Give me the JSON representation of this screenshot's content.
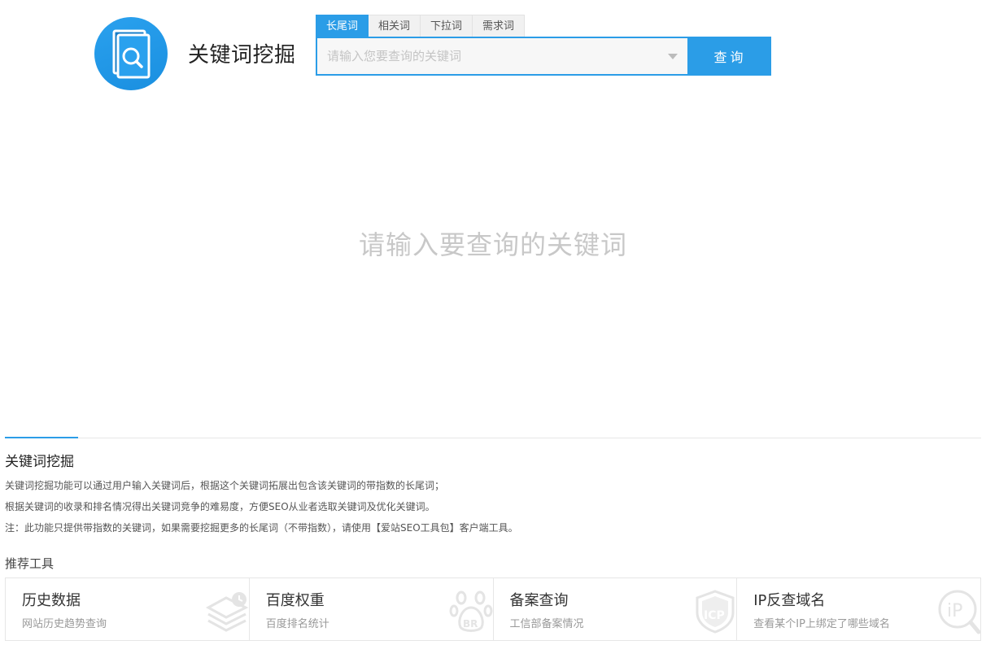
{
  "header": {
    "title": "关键词挖掘",
    "logo_icon": "search-document-icon"
  },
  "search": {
    "tabs": [
      {
        "label": "长尾词",
        "active": true
      },
      {
        "label": "相关词",
        "active": false
      },
      {
        "label": "下拉词",
        "active": false
      },
      {
        "label": "需求词",
        "active": false
      }
    ],
    "placeholder": "请输入您要查询的关键词",
    "value": "",
    "button_label": "查询"
  },
  "main": {
    "empty_hint": "请输入要查询的关键词"
  },
  "description": {
    "title": "关键词挖掘",
    "lines": [
      "关键词挖掘功能可以通过用户输入关键词后，根据这个关键词拓展出包含该关键词的带指数的长尾词；",
      "根据关键词的收录和排名情况得出关键词竞争的难易度，方便SEO从业者选取关键词及优化关键词。",
      "注：此功能只提供带指数的关键词，如果需要挖掘更多的长尾词（不带指数），请使用【爱站SEO工具包】客户端工具。"
    ]
  },
  "recommended": {
    "title": "推荐工具",
    "tools": [
      {
        "name": "历史数据",
        "desc": "网站历史趋势查询",
        "icon": "stacked-layers-icon"
      },
      {
        "name": "百度权重",
        "desc": "百度排名统计",
        "icon": "paw-br-icon"
      },
      {
        "name": "备案查询",
        "desc": "工信部备案情况",
        "icon": "shield-icp-icon"
      },
      {
        "name": "IP反查域名",
        "desc": "查看某个IP上绑定了哪些域名",
        "icon": "ip-search-icon"
      }
    ]
  },
  "colors": {
    "accent": "#2b9de7",
    "logo_bg": "#1a8fe0",
    "hint_text": "#c8c8c8",
    "border": "#e6e6e6"
  }
}
